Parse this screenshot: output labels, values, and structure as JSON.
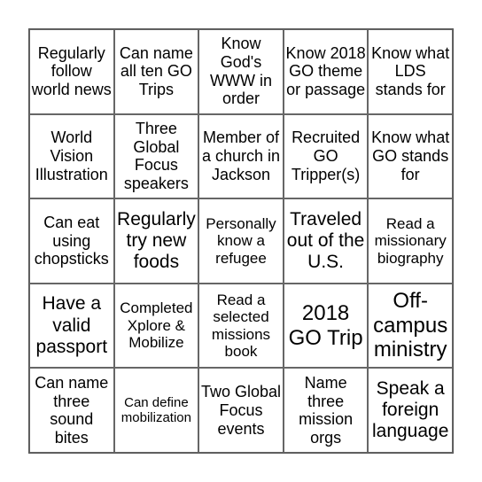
{
  "board": {
    "rows": [
      [
        "Regularly follow world news",
        "Can name all ten GO Trips",
        "Know God's WWW in order",
        "Know 2018 GO theme or passage",
        "Know what LDS stands for"
      ],
      [
        "World Vision Illustration",
        "Three Global Focus speakers",
        "Member of a church in Jackson",
        "Recruited GO Tripper(s)",
        "Know what GO stands for"
      ],
      [
        "Can eat using chopsticks",
        "Regularly try new foods",
        "Personally know a refugee",
        "Traveled out of the U.S.",
        "Read a missionary biography"
      ],
      [
        "Have a valid passport",
        "Completed Xplore & Mobilize",
        "Read a selected missions book",
        "2018 GO Trip",
        "Off-campus ministry"
      ],
      [
        "Can name three sound bites",
        "Can define mobilization",
        "Two Global Focus events",
        "Name three mission orgs",
        "Speak a foreign language"
      ]
    ]
  }
}
